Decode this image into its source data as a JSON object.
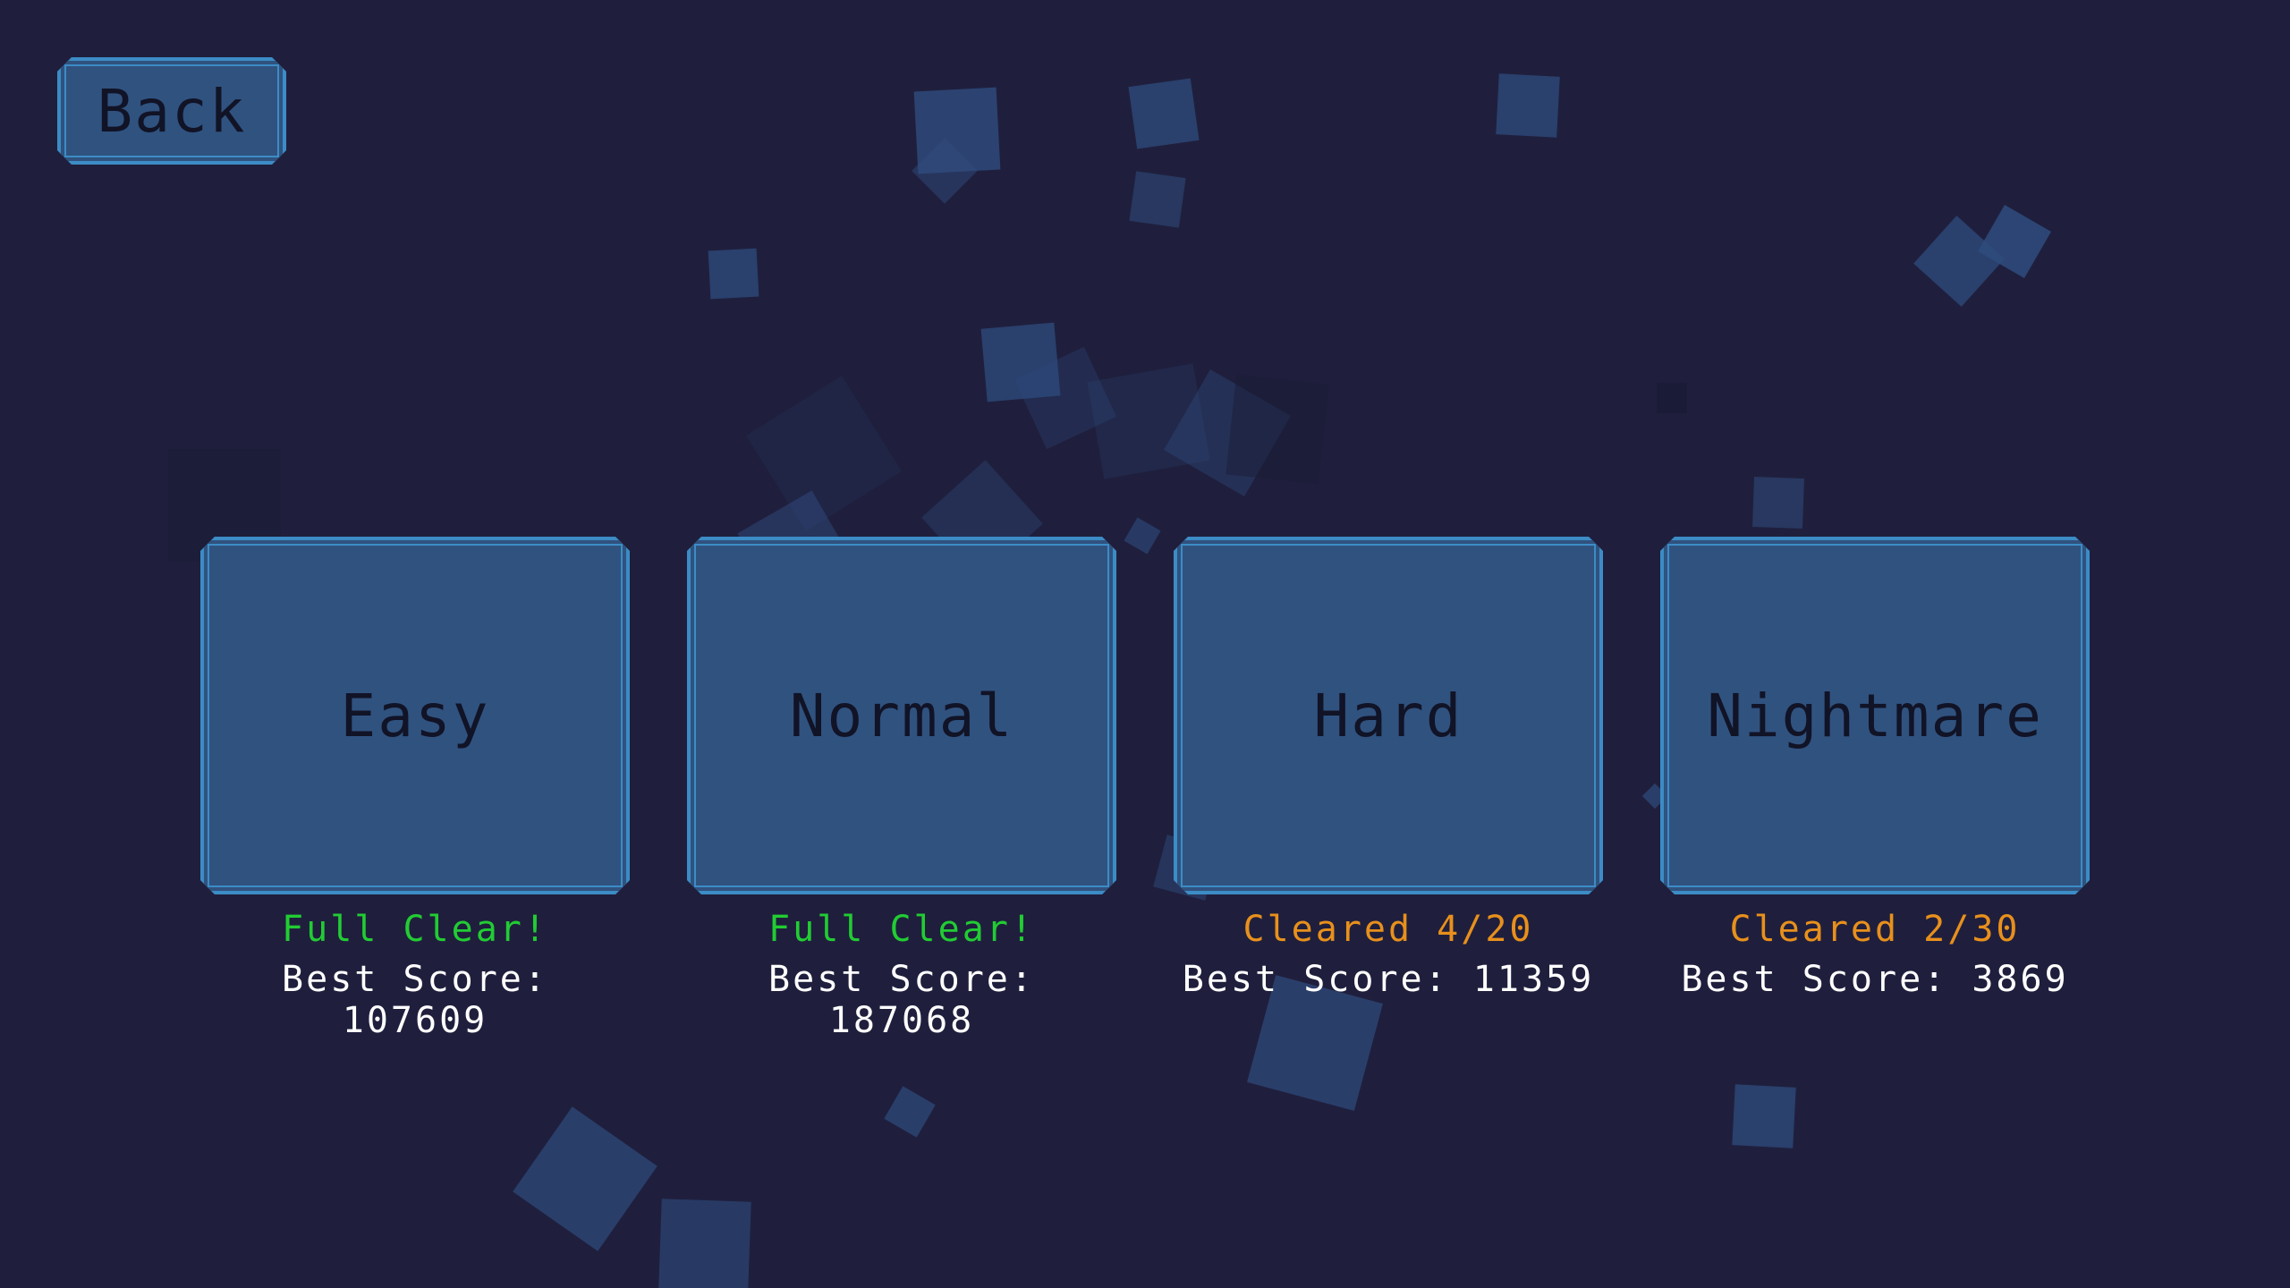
{
  "header": {
    "back_label": "Back"
  },
  "difficulties": [
    {
      "label": "Easy",
      "status": "Full Clear!",
      "status_color": "#22cc33",
      "score": "Best Score: 107609"
    },
    {
      "label": "Normal",
      "status": "Full Clear!",
      "status_color": "#22cc33",
      "score": "Best Score: 187068"
    },
    {
      "label": "Hard",
      "status": "Cleared 4/20",
      "status_color": "#e8901c",
      "score": "Best Score: 11359"
    },
    {
      "label": "Nightmare",
      "status": "Cleared 2/30",
      "status_color": "#e8901c",
      "score": "Best Score: 3869"
    }
  ],
  "theme": {
    "background": "#1f1f3d",
    "button_fill": "#30527f",
    "button_border": "#3c8cc6",
    "button_text": "#111326",
    "score_text": "#ffffff"
  }
}
